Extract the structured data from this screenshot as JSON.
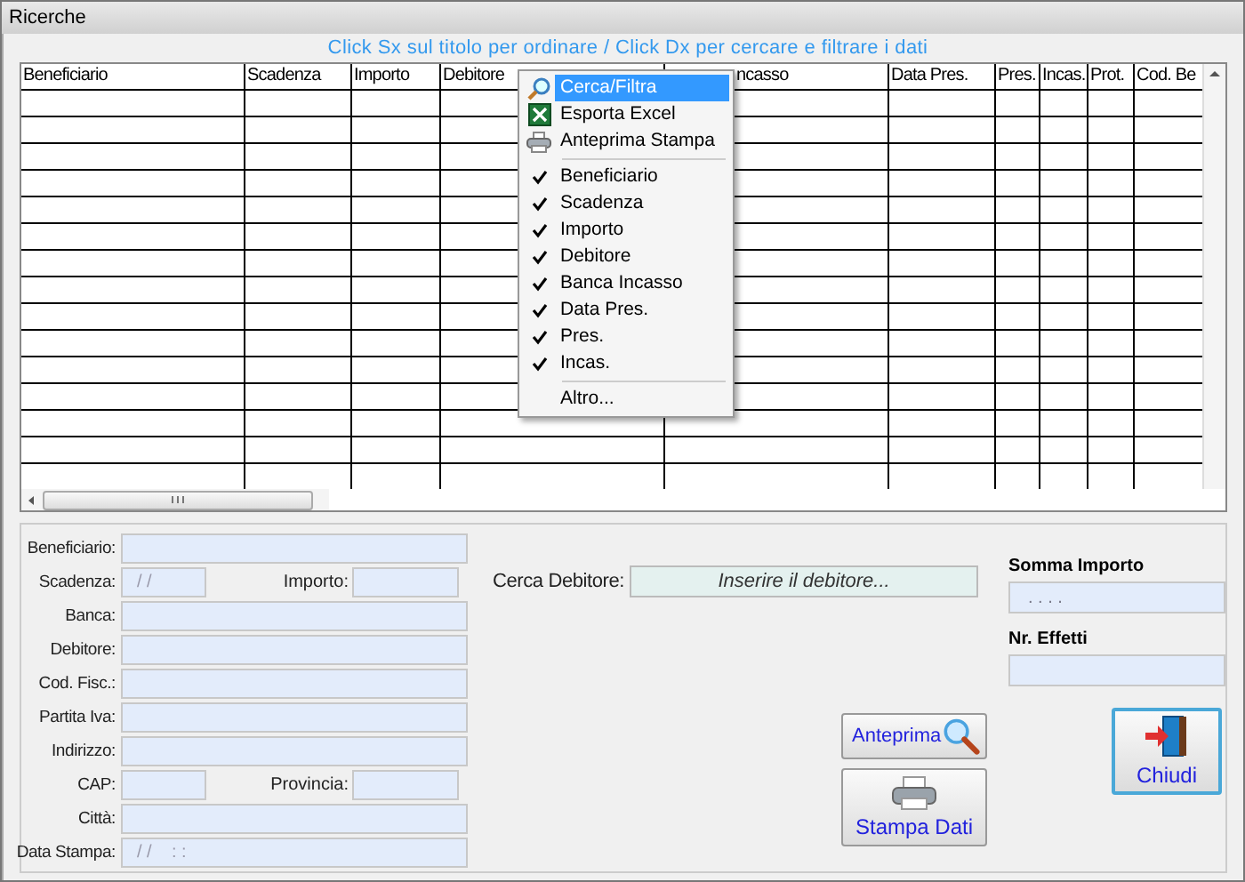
{
  "window": {
    "title": "Ricerche"
  },
  "hint": "Click Sx sul titolo per ordinare / Click Dx per cercare e filtrare i dati",
  "table": {
    "columns": [
      {
        "label": "Beneficiario"
      },
      {
        "label": "Scadenza"
      },
      {
        "label": "Importo"
      },
      {
        "label": "Debitore"
      },
      {
        "label": "ncasso"
      },
      {
        "label": "Data Pres."
      },
      {
        "label": "Pres."
      },
      {
        "label": "Incas."
      },
      {
        "label": "Prot."
      },
      {
        "label": "Cod. Be"
      }
    ]
  },
  "menu": {
    "items": [
      {
        "kind": "search",
        "label": "Cerca/Filtra",
        "selected": true
      },
      {
        "kind": "excel",
        "label": "Esporta Excel",
        "selected": false
      },
      {
        "kind": "print",
        "label": "Anteprima Stampa",
        "selected": false
      },
      {
        "kind": "separator"
      },
      {
        "kind": "check",
        "label": "Beneficiario",
        "checked": true,
        "selected": false
      },
      {
        "kind": "check",
        "label": "Scadenza",
        "checked": true,
        "selected": false
      },
      {
        "kind": "check",
        "label": "Importo",
        "checked": true,
        "selected": false
      },
      {
        "kind": "check",
        "label": "Debitore",
        "checked": true,
        "selected": false
      },
      {
        "kind": "check",
        "label": "Banca Incasso",
        "checked": true,
        "selected": false
      },
      {
        "kind": "check",
        "label": "Data Pres.",
        "checked": true,
        "selected": false
      },
      {
        "kind": "check",
        "label": "Pres.",
        "checked": true,
        "selected": false
      },
      {
        "kind": "check",
        "label": "Incas.",
        "checked": true,
        "selected": false
      },
      {
        "kind": "separator"
      },
      {
        "kind": "plain",
        "label": "Altro...",
        "selected": false
      }
    ]
  },
  "form": {
    "rows": [
      {
        "kind": "single",
        "label": "Beneficiario:"
      },
      {
        "kind": "pair",
        "label": "Scadenza:",
        "value": "/ /",
        "label2": "Importo:"
      },
      {
        "kind": "single",
        "label": "Banca:"
      },
      {
        "kind": "single",
        "label": "Debitore:"
      },
      {
        "kind": "single",
        "label": "Cod. Fisc.:"
      },
      {
        "kind": "single",
        "label": "Partita Iva:"
      },
      {
        "kind": "single",
        "label": "Indirizzo:"
      },
      {
        "kind": "pair",
        "label": "CAP:",
        "label2": "Provincia:"
      },
      {
        "kind": "single",
        "label": "Città:"
      },
      {
        "kind": "single",
        "label": "Data Stampa:",
        "value": "/ /    : :"
      }
    ]
  },
  "search": {
    "label": "Cerca Debitore:",
    "placeholder": "Inserire il debitore..."
  },
  "totals": [
    {
      "label": "Somma Importo",
      "value": ". . . ."
    },
    {
      "label": "Nr. Effetti"
    }
  ],
  "buttons": {
    "preview": "Anteprima",
    "print": "Stampa Dati",
    "close": "Chiudi"
  }
}
